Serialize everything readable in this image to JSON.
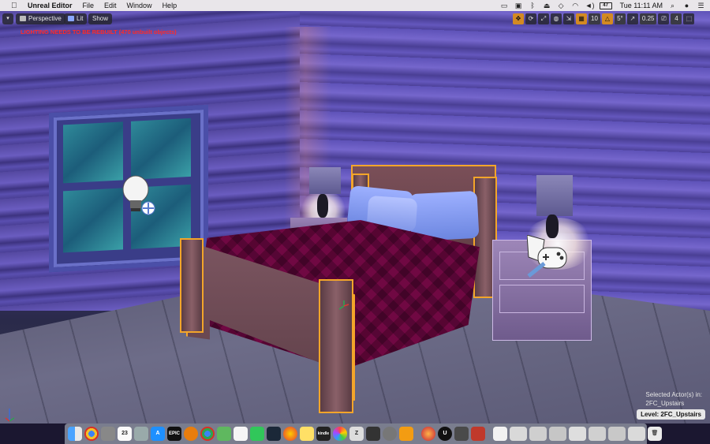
{
  "menubar": {
    "app_name": "Unreal Editor",
    "menus": [
      "File",
      "Edit",
      "Window",
      "Help"
    ],
    "battery_label": "47",
    "clock": "Tue 11:11 AM"
  },
  "viewport": {
    "perspective_label": "Perspective",
    "lit_label": "Lit",
    "show_label": "Show",
    "warning": "LIGHTING NEEDS TO BE REBUILT (470 unbuilt objects)",
    "grid_snap": "10",
    "rotation_snap": "5°",
    "scale_snap": "0.25",
    "camera_speed": "4",
    "selected_actors_label": "Selected Actor(s) in:",
    "selected_actors_level": "2FC_Upstairs",
    "level_badge": "Level:  2FC_Upstairs"
  },
  "colors": {
    "selection_outline": "#f3a52a",
    "toggle_active": "#d38a22",
    "warning_text": "#ff2a2a"
  },
  "dock": {
    "icons": [
      "finder-icon",
      "chrome-icon",
      "launchpad-icon",
      "calendar-icon",
      "rocket-icon",
      "app-store-icon",
      "epic-games-icon",
      "blender-icon",
      "chrome-icon",
      "maps-icon",
      "notes-icon",
      "messages-icon",
      "steam-icon",
      "marble-icon",
      "stickies-icon",
      "kindle-icon",
      "photos-icon",
      "zbrush-icon",
      "clapper-icon",
      "system-prefs-icon",
      "sublime-icon",
      "colorsync-icon",
      "unreal-icon",
      "hdri-icon",
      "substance-icon",
      "document-icon",
      "window-1-icon",
      "window-2-icon",
      "window-3-icon",
      "window-4-icon",
      "window-5-icon",
      "window-6-icon",
      "window-7-icon",
      "trash-icon"
    ],
    "calendar_day": "23",
    "epic_label": "EPIC",
    "kindle_label": "kindle"
  }
}
